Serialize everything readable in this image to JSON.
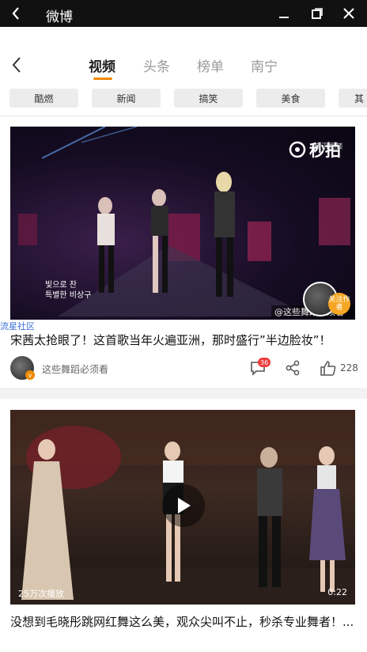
{
  "window": {
    "title": "微博",
    "back_icon": "chevron-left-icon",
    "controls": [
      "minimize-icon",
      "restore-icon",
      "close-icon"
    ]
  },
  "tabs": {
    "items": [
      {
        "label": "视频",
        "active": true
      },
      {
        "label": "头条",
        "active": false
      },
      {
        "label": "榜单",
        "active": false
      },
      {
        "label": "南宁",
        "active": false
      }
    ],
    "accent": "#f08a00"
  },
  "chips": [
    "酷燃",
    "新闻",
    "搞笑",
    "美食",
    "其"
  ],
  "post1": {
    "watermark": "秒拍",
    "watermark_small": "腾讯视频",
    "subtitle_line1": "빛으로 찬",
    "subtitle_line2": "특별한 비상구",
    "follow_label": "关注作者",
    "author_watermark": "@这些舞蹈必须看",
    "overlay_tag": "流星社区",
    "title": "宋茜太抢眼了！这首歌当年火遍亚洲，那时盛行”半边脸妆”！",
    "author": "这些舞蹈必须看",
    "comment_count": "36",
    "like_count": "228"
  },
  "post2": {
    "plays": "25万次播放",
    "duration": "0:22",
    "title": "没想到毛晓彤跳网红舞这么美，观众尖叫不止，秒杀专业舞者！..."
  }
}
